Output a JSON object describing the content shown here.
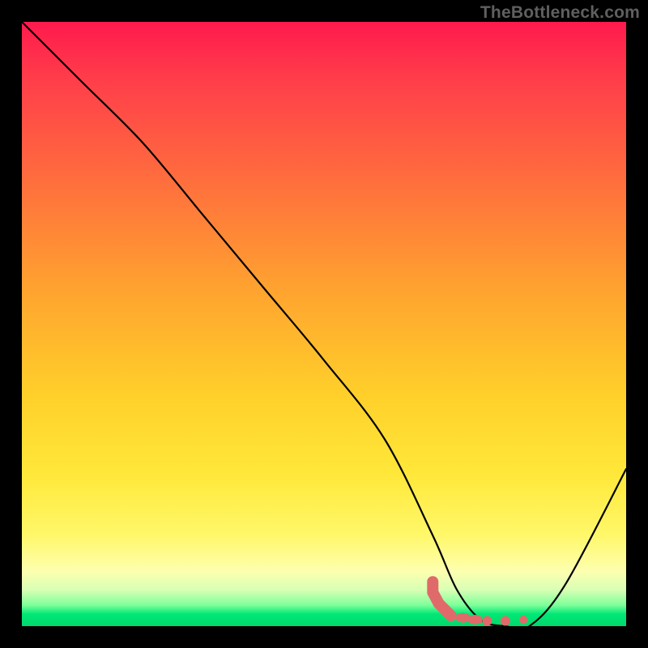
{
  "watermark": "TheBottleneck.com",
  "chart_data": {
    "type": "line",
    "title": "",
    "xlabel": "",
    "ylabel": "",
    "xlim": [
      0,
      100
    ],
    "ylim": [
      0,
      100
    ],
    "series": [
      {
        "name": "bottleneck-curve",
        "x": [
          0,
          10,
          20,
          30,
          40,
          50,
          60,
          68,
          72,
          76,
          80,
          84,
          90,
          100
        ],
        "y": [
          100,
          90,
          80,
          68,
          56,
          44,
          31,
          15,
          6,
          1,
          0,
          0,
          7,
          26
        ]
      }
    ],
    "markers": {
      "name": "highlight-cluster",
      "color": "#e06a6a",
      "points": [
        {
          "x": 68,
          "y": 6
        },
        {
          "x": 69,
          "y": 4
        },
        {
          "x": 70,
          "y": 3
        },
        {
          "x": 71,
          "y": 2
        },
        {
          "x": 73,
          "y": 1.5
        },
        {
          "x": 75,
          "y": 1.2
        },
        {
          "x": 77,
          "y": 1.0
        },
        {
          "x": 80,
          "y": 1.0
        },
        {
          "x": 83,
          "y": 1.2
        }
      ]
    },
    "gradient_stops": [
      {
        "pos": 0,
        "color": "#ff1a4d"
      },
      {
        "pos": 25,
        "color": "#ff6a3e"
      },
      {
        "pos": 62,
        "color": "#ffd02a"
      },
      {
        "pos": 91,
        "color": "#fdffb0"
      },
      {
        "pos": 98,
        "color": "#00e876"
      }
    ]
  }
}
